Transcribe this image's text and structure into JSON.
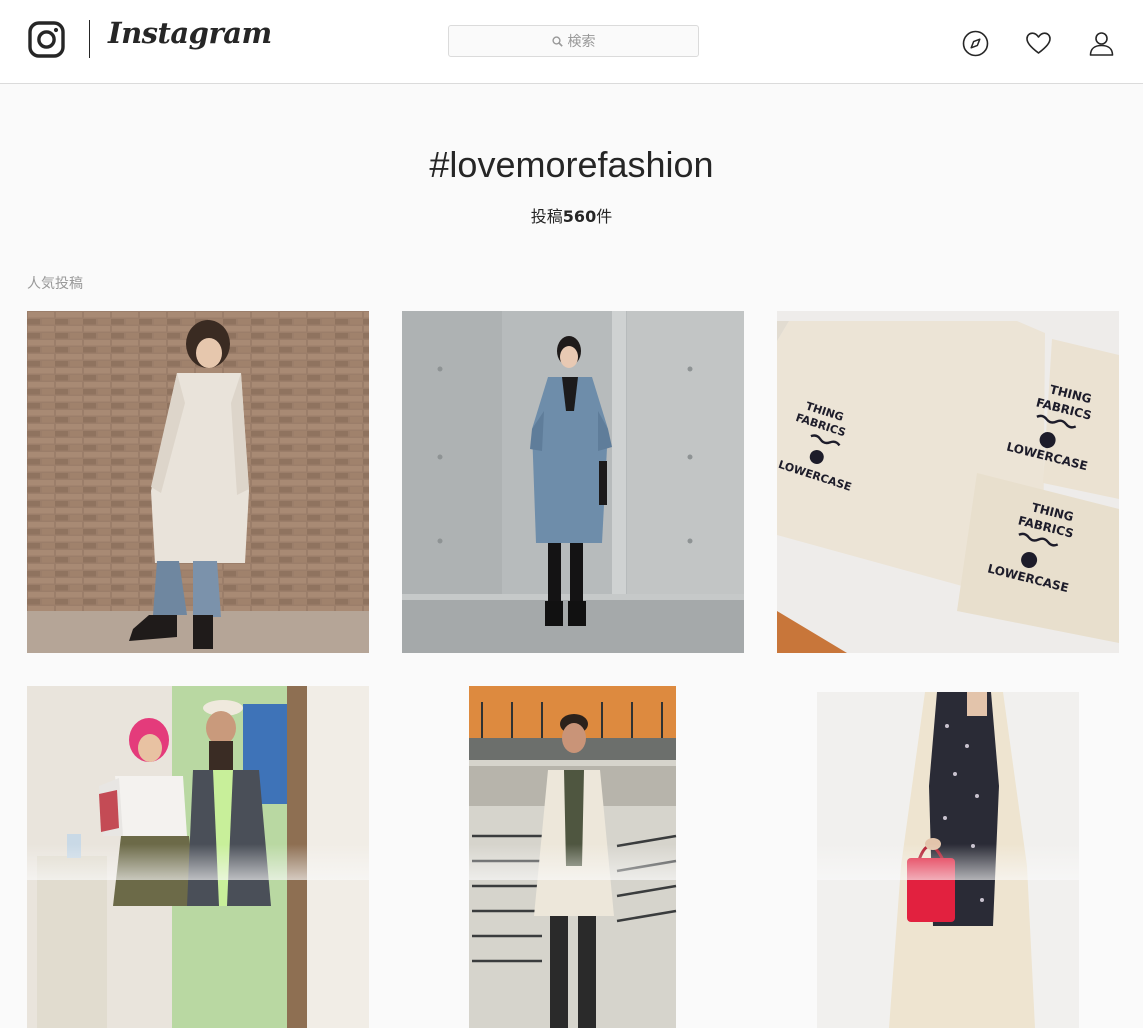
{
  "header": {
    "wordmark": "Instagram",
    "search_placeholder": "検索"
  },
  "hashtag": {
    "title": "#lovemorefashion",
    "count_prefix": "投稿",
    "count_number": "560",
    "count_suffix": "件"
  },
  "section": {
    "label": "人気投稿"
  },
  "posts": [
    {
      "alt": "woman in white coat against brick wall"
    },
    {
      "alt": "woman in blue coat against concrete wall"
    },
    {
      "alt": "towels with embroidered logo",
      "towel_top": [
        "THING",
        "FABRICS",
        "LOWERCASE"
      ],
      "towel_mid": [
        "THING",
        "FABRICS",
        "LOWERCASE"
      ],
      "towel_bottom": [
        "THING",
        "FABRICS",
        "LOWERCASE"
      ]
    },
    {
      "alt": "two people posing indoors"
    },
    {
      "alt": "man in cream cardigan by stairs"
    },
    {
      "alt": "woman in floral dress and cream coat"
    }
  ],
  "colors": {
    "accent_text": "#262626",
    "muted_text": "#999999",
    "border": "#dbdbdb",
    "background": "#fafafa"
  },
  "icons": {
    "logo": "camera-glyph-icon",
    "search": "search-icon",
    "explore": "compass-icon",
    "activity": "heart-icon",
    "profile": "user-icon"
  }
}
